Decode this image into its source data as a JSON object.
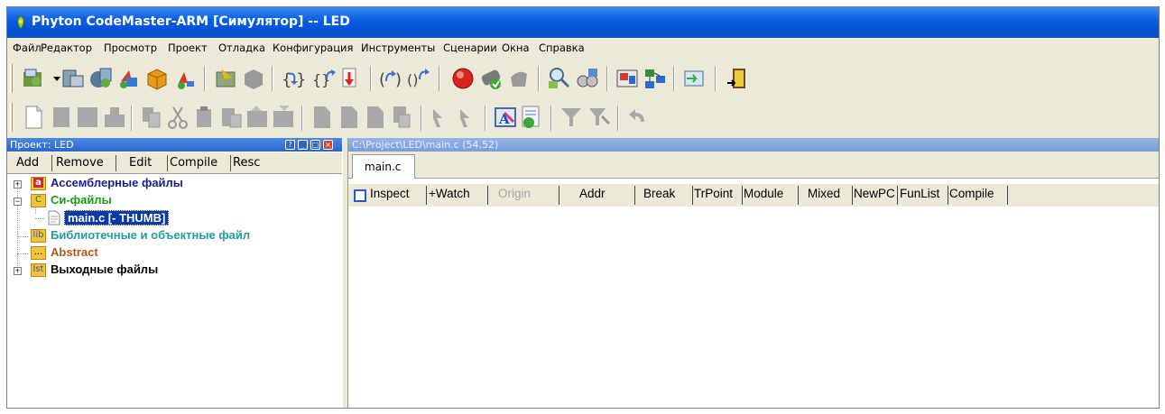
{
  "window": {
    "title": "Phyton CodeMaster-ARM [Симулятор] -- LED"
  },
  "menu": [
    "Файл",
    "Редактор",
    "Просмотр",
    "Проект",
    "Отладка",
    "Конфигурация",
    "Инструменты",
    "Сценарии",
    "Окна",
    "Справка"
  ],
  "toolbar1": [
    "open-project-icon",
    "dropdown-arrow-icon",
    "project-settings-icon",
    "project-build-icon",
    "project-options-icon",
    "project-package-icon",
    "project-run-icon",
    "load-program-icon",
    "memory-chip-icon",
    "step-into-icon",
    "step-over-icon",
    "step-out-icon",
    "run-to-cursor-icon",
    "animate-icon",
    "stop-icon",
    "reset-icon",
    "breakpoints-icon",
    "inspect-icon",
    "watch-icon",
    "cpu-view-icon",
    "memory-view-icon",
    "io-stream-icon",
    "exit-icon"
  ],
  "toolbar2": [
    "new-file-icon",
    "save-icon",
    "save-all-icon",
    "print-icon",
    "copy-icon",
    "cut-icon",
    "paste-icon",
    "clipboard-icon",
    "undo-file-icon",
    "redo-file-icon",
    "bookmark-icon",
    "bookmark-next-icon",
    "bookmark-prev-icon",
    "find-icon",
    "find-next-icon",
    "find-prev-icon",
    "format-icon",
    "script-icon",
    "filter-icon",
    "filter-edit-icon",
    "undo-icon"
  ],
  "project_panel": {
    "title": "Проект: LED",
    "tabs": [
      "Add",
      "Remove",
      "Edit",
      "Compile",
      "Resc"
    ],
    "tree": [
      {
        "icon_text": "a",
        "label": "Ассемблерные файлы",
        "color": "#1b1b8f",
        "expander": "+"
      },
      {
        "icon_text": "C",
        "label": "Си-файлы",
        "color": "#1a9a1a",
        "expander": "-"
      },
      {
        "label": "main.c [- THUMB]",
        "selected": true
      },
      {
        "icon_text": "lib",
        "label": "Библиотечные и объектные файл",
        "color": "#1f9f9f"
      },
      {
        "icon_text": "...",
        "label": "Abstract",
        "color": "#b0581a"
      },
      {
        "icon_text": "lst",
        "label": "Выходные файлы",
        "color": "#000000",
        "expander": "+"
      }
    ]
  },
  "editor": {
    "title": "C:\\Project\\LED\\main.c (54,52)",
    "tab": "main.c",
    "buttons": [
      "Inspect",
      "+Watch",
      "Origin",
      "Addr",
      "Break",
      "TrPoint",
      "Module",
      "Mixed",
      "NewPC",
      "FunList",
      "Compile"
    ],
    "disabled": [
      "Origin"
    ]
  }
}
